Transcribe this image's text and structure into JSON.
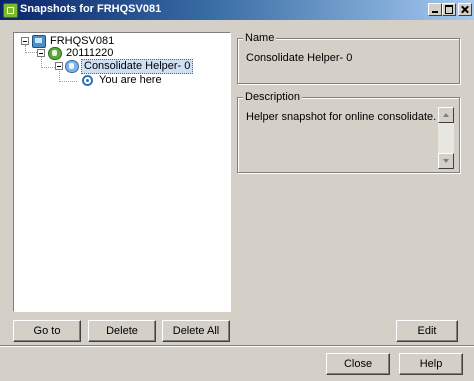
{
  "window": {
    "title": "Snapshots for FRHQSV081"
  },
  "tree": {
    "nodes": [
      {
        "label": "FRHQSV081",
        "icon": "vm-icon"
      },
      {
        "label": "20111220",
        "icon": "snapshot-icon"
      },
      {
        "label": "Consolidate Helper- 0",
        "icon": "snapshot-selected-icon"
      },
      {
        "label": "You are here",
        "icon": "you-are-here-icon"
      }
    ]
  },
  "left_buttons": {
    "goto": "Go to",
    "delete": "Delete",
    "delete_all": "Delete All"
  },
  "name_group": {
    "legend": "Name",
    "value": "Consolidate Helper- 0"
  },
  "description_group": {
    "legend": "Description",
    "value": "Helper snapshot for online consolidate."
  },
  "edit_label": "Edit",
  "footer": {
    "close": "Close",
    "help": "Help"
  }
}
